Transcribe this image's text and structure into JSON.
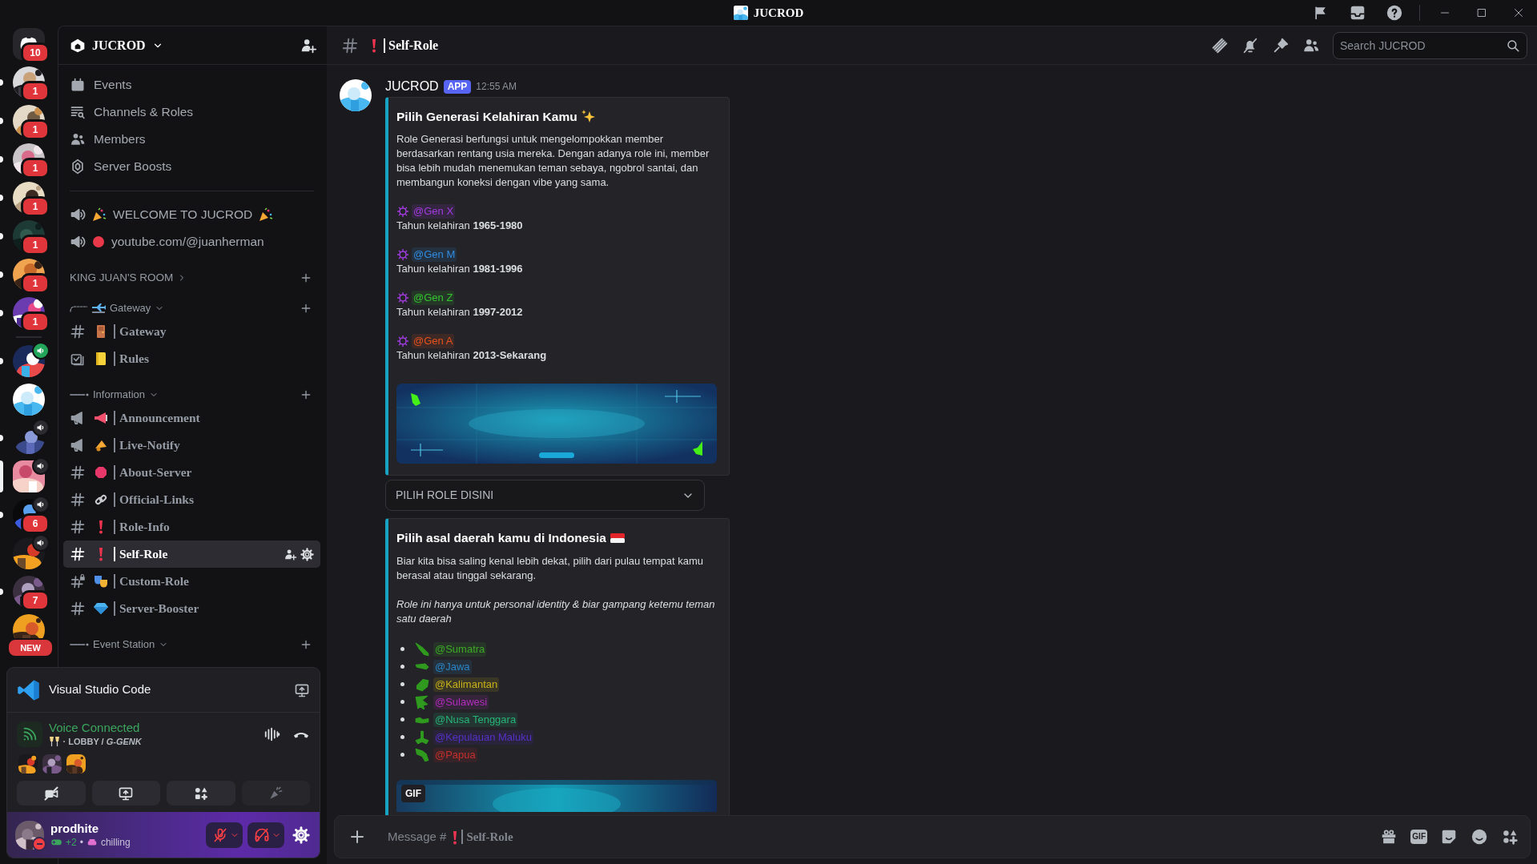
{
  "title_bar": {
    "title": "JUCROD"
  },
  "servers": [
    {
      "kind": "home",
      "badge": "10",
      "unread": false,
      "selected": false,
      "voice": false
    },
    {
      "kind": "picture",
      "badge": "1",
      "unread": true,
      "selected": false,
      "voice": false
    },
    {
      "kind": "picture",
      "badge": "1",
      "unread": true,
      "selected": false,
      "voice": false
    },
    {
      "kind": "picture",
      "badge": "1",
      "unread": true,
      "selected": false,
      "voice": false
    },
    {
      "kind": "picture",
      "badge": "1",
      "unread": true,
      "selected": false,
      "voice": false
    },
    {
      "kind": "picture",
      "badge": "1",
      "unread": true,
      "selected": false,
      "voice": false
    },
    {
      "kind": "picture",
      "badge": "1",
      "unread": true,
      "selected": false,
      "voice": false
    },
    {
      "kind": "picture",
      "badge": "1",
      "unread": true,
      "selected": false,
      "voice": false
    },
    {
      "kind": "separator"
    },
    {
      "kind": "picture",
      "unread": true,
      "selected": false,
      "voice": true,
      "connected": true
    },
    {
      "kind": "picture",
      "unread": false,
      "selected": false,
      "voice": false
    },
    {
      "kind": "picture",
      "unread": true,
      "selected": false,
      "voice": true,
      "connected": false
    },
    {
      "kind": "picture",
      "unread": false,
      "selected": true,
      "voice": true,
      "connected": false
    },
    {
      "kind": "picture",
      "badge": "6",
      "unread": true,
      "selected": false,
      "voice": true,
      "connected": false
    },
    {
      "kind": "picture",
      "unread": false,
      "selected": false,
      "voice": true,
      "connected": false
    },
    {
      "kind": "picture",
      "badge": "7",
      "unread": true,
      "selected": false,
      "voice": false
    },
    {
      "kind": "picture",
      "new_label": "NEW",
      "unread": false,
      "selected": false,
      "voice": false
    }
  ],
  "channel_sidebar": {
    "server_name": "JUCROD",
    "menu": [
      {
        "label": "Events"
      },
      {
        "label": "Channels & Roles"
      },
      {
        "label": "Members"
      },
      {
        "label": "Server Boosts"
      }
    ],
    "pinned": [
      {
        "label": "WELCOME TO JUCROD"
      },
      {
        "label": "youtube.com/@juanherman"
      }
    ],
    "sections": [
      {
        "name": "KING JUAN'S ROOM",
        "kind": "plain",
        "expanded": false
      },
      {
        "name": "Gateway",
        "kind": "branch",
        "expanded": true,
        "channels": [
          {
            "kind": "text",
            "name": "Gateway",
            "selected": false
          },
          {
            "kind": "rules",
            "name": "Rules",
            "selected": false
          }
        ]
      },
      {
        "name": "Information",
        "kind": "dash",
        "expanded": true,
        "channels": [
          {
            "kind": "announcement",
            "name": "Announcement",
            "selected": false
          },
          {
            "kind": "announcement",
            "name": "Live-Notify",
            "selected": false
          },
          {
            "kind": "text",
            "name": "About-Server",
            "selected": false
          },
          {
            "kind": "text",
            "name": "Official-Links",
            "selected": false
          },
          {
            "kind": "text",
            "name": "Role-Info",
            "selected": false
          },
          {
            "kind": "text",
            "name": "Self-Role",
            "selected": true
          },
          {
            "kind": "locked",
            "name": "Custom-Role",
            "selected": false
          },
          {
            "kind": "text",
            "name": "Server-Booster",
            "selected": false
          }
        ]
      },
      {
        "name": "Event Station",
        "kind": "dash",
        "expanded": true
      }
    ]
  },
  "voice_panel": {
    "activity": "Visual Studio Code",
    "status": "Voice Connected",
    "location": "· LOBBY / *G-GENK*",
    "participants": [
      {
        "kind": "picture"
      },
      {
        "kind": "picture"
      },
      {
        "kind": "picture"
      }
    ],
    "controls": [
      {
        "kind": "camera",
        "disabled": false
      },
      {
        "kind": "screen",
        "disabled": false
      },
      {
        "kind": "activities",
        "disabled": false
      },
      {
        "kind": "soundboard",
        "disabled": true
      }
    ]
  },
  "user": {
    "name": "prodhite",
    "do_not_disturb": true,
    "extra": "+2",
    "separator": "•",
    "activity": "chilling",
    "muted": true,
    "deafened": true
  },
  "header": {
    "channel": "Self-Role",
    "search": {
      "placeholder": "Search JUCROD"
    }
  },
  "message": {
    "author": "JUCROD",
    "tag": "APP",
    "time": "12:55 AM",
    "components": [
      {
        "kind": "embed",
        "title": "Pilih Generasi Kelahiran Kamu",
        "paragraphs": [
          {
            "text": "Role Generasi berfungsi untuk mengelompokkan member berdasarkan rentang usia mereka. Dengan adanya role ini, member bisa lebih mudah menemukan teman sebaya, ngobrol santai, dan membangun koneksi dengan vibe yang sama.",
            "italic": false
          }
        ],
        "roles": [
          {
            "mention": "@Gen X",
            "color": "#a23be0",
            "detail": "Tahun kelahiran **1965-1980**"
          },
          {
            "mention": "@Gen M",
            "color": "#2f8ce0",
            "detail": "Tahun kelahiran **1981-1996**"
          },
          {
            "mention": "@Gen Z",
            "color": "#35c42f",
            "detail": "Tahun kelahiran **1997-2012**"
          },
          {
            "mention": "@Gen A",
            "color": "#e8521c",
            "detail": "Tahun kelahiran **2013-Sekarang**"
          }
        ],
        "image": {
          "kind": "picture"
        }
      },
      {
        "kind": "select",
        "placeholder": "PILIH ROLE DISINI"
      },
      {
        "kind": "embed",
        "title": "Pilih asal daerah kamu di Indonesia",
        "paragraphs": [
          {
            "text": "Biar kita bisa saling kenal lebih dekat, pilih dari pulau tempat kamu berasal atau tinggal sekarang.",
            "italic": false
          },
          {
            "text": "Role ini hanya untuk personal identity & biar gampang ketemu teman satu daerah",
            "italic": true
          }
        ],
        "list": [
          {
            "mention": "@Sumatra",
            "color": "#3dab26"
          },
          {
            "mention": "@Jawa",
            "color": "#2a86c6"
          },
          {
            "mention": "@Kalimantan",
            "color": "#c8b11a"
          },
          {
            "mention": "@Sulawesi",
            "color": "#b12cbb"
          },
          {
            "mention": "@Nusa Tenggara",
            "color": "#27b478"
          },
          {
            "mention": "@Kepulauan Maluku",
            "color": "#5630c6"
          },
          {
            "mention": "@Papua",
            "color": "#c6302c"
          }
        ],
        "gif": {
          "label": "GIF"
        }
      }
    ]
  },
  "composer": {
    "placeholder": "Message #",
    "channel": "Self-Role",
    "gif_button": "GIF"
  }
}
